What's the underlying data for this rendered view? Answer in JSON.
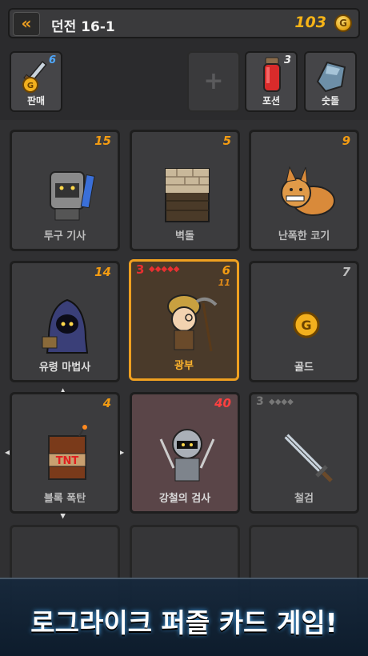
{
  "header": {
    "back_icon": "double-chevron-left-icon",
    "title": "던전 16-1",
    "gold": "103",
    "coin_letter": "G"
  },
  "inventory": {
    "sell": {
      "label": "판매",
      "count": "6",
      "icon": "sword-coin-icon"
    },
    "empty_slot_icon": "plus-icon",
    "potion": {
      "label": "포션",
      "count": "3",
      "icon": "potion-icon"
    },
    "whetstone": {
      "label": "숫돌",
      "icon": "whetstone-icon"
    }
  },
  "cards": [
    {
      "name": "투구 기사",
      "value": "15",
      "icon": "helmet-knight-icon"
    },
    {
      "name": "벽돌",
      "value": "5",
      "icon": "brick-wall-icon"
    },
    {
      "name": "난폭한 코기",
      "value": "9",
      "icon": "corgi-icon"
    },
    {
      "name": "유령 마법사",
      "value": "14",
      "icon": "ghost-mage-icon"
    },
    {
      "name": "광부",
      "value": "6",
      "level": "3",
      "dots": "◆◆◆◆◆",
      "sub": "11",
      "icon": "miner-icon"
    },
    {
      "name": "골드",
      "value": "7",
      "icon": "gold-coin-icon"
    },
    {
      "name": "블록 폭탄",
      "value": "4",
      "icon": "tnt-block-icon",
      "tnt": "TNT"
    },
    {
      "name": "강철의 검사",
      "value": "40",
      "icon": "steel-swordsman-icon"
    },
    {
      "name": "철검",
      "level": "3",
      "dots": "◆◆◆◆",
      "icon": "iron-sword-icon"
    }
  ],
  "banner": {
    "text": "로그라이크 퍼즐 카드 게임!"
  },
  "colors": {
    "accent": "#f0a020",
    "gold": "#f7b417",
    "danger": "#e83030"
  }
}
